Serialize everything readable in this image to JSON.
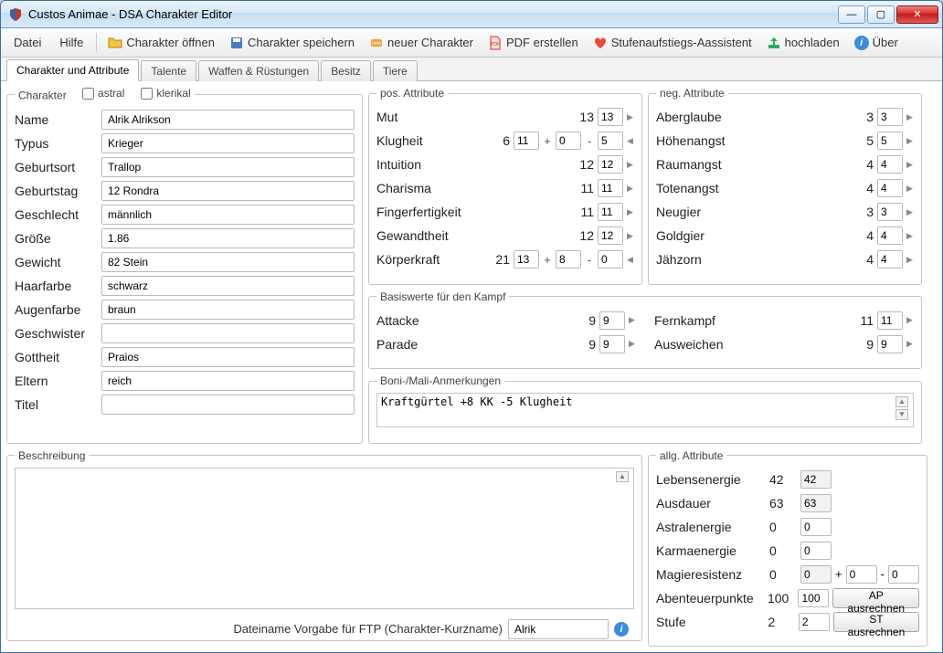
{
  "window": {
    "title": "Custos Animae - DSA Charakter Editor"
  },
  "menus": {
    "datei": "Datei",
    "hilfe": "Hilfe"
  },
  "toolbar": {
    "open": "Charakter öffnen",
    "save": "Charakter speichern",
    "new": "neuer Charakter",
    "pdf": "PDF erstellen",
    "levelup": "Stufenaufstiegs-Aassistent",
    "upload": "hochladen",
    "about": "Über"
  },
  "tabs": {
    "t0": "Charakter und Attribute",
    "t1": "Talente",
    "t2": "Waffen & Rüstungen",
    "t3": "Besitz",
    "t4": "Tiere"
  },
  "char": {
    "legend": "Charakter",
    "astral_lbl": "astral",
    "klerikal_lbl": "klerikal",
    "name_lbl": "Name",
    "name": "Alrik Alrikson",
    "typus_lbl": "Typus",
    "typus": "Krieger",
    "geburtsort_lbl": "Geburtsort",
    "geburtsort": "Trallop",
    "geburtstag_lbl": "Geburtstag",
    "geburtstag": "12 Rondra",
    "geschlecht_lbl": "Geschlecht",
    "geschlecht": "männlich",
    "groesse_lbl": "Größe",
    "groesse": "1.86",
    "gewicht_lbl": "Gewicht",
    "gewicht": "82 Stein",
    "haarfarbe_lbl": "Haarfarbe",
    "haarfarbe": "schwarz",
    "augenfarbe_lbl": "Augenfarbe",
    "augenfarbe": "braun",
    "geschwister_lbl": "Geschwister",
    "geschwister": "",
    "gottheit_lbl": "Gottheit",
    "gottheit": "Praios",
    "eltern_lbl": "Eltern",
    "eltern": "reich",
    "titel_lbl": "Titel",
    "titel": ""
  },
  "pos": {
    "legend": "pos. Attribute",
    "mut_lbl": "Mut",
    "mut_v": "13",
    "mut_i": "13",
    "klugheit_lbl": "Klugheit",
    "klugheit_v": "6",
    "klugheit_i1": "11",
    "klugheit_i2": "0",
    "klugheit_i3": "5",
    "intuition_lbl": "Intuition",
    "intuition_v": "12",
    "intuition_i": "12",
    "charisma_lbl": "Charisma",
    "charisma_v": "11",
    "charisma_i": "11",
    "ff_lbl": "Fingerfertigkeit",
    "ff_v": "11",
    "ff_i": "11",
    "ge_lbl": "Gewandtheit",
    "ge_v": "12",
    "ge_i": "12",
    "kk_lbl": "Körperkraft",
    "kk_v": "21",
    "kk_i1": "13",
    "kk_i2": "8",
    "kk_i3": "0"
  },
  "neg": {
    "legend": "neg. Attribute",
    "aberglaube_lbl": "Aberglaube",
    "aberglaube_v": "3",
    "aberglaube_i": "3",
    "hoehenangst_lbl": "Höhenangst",
    "hoehenangst_v": "5",
    "hoehenangst_i": "5",
    "raumangst_lbl": "Raumangst",
    "raumangst_v": "4",
    "raumangst_i": "4",
    "totenangst_lbl": "Totenangst",
    "totenangst_v": "4",
    "totenangst_i": "4",
    "neugier_lbl": "Neugier",
    "neugier_v": "3",
    "neugier_i": "3",
    "goldgier_lbl": "Goldgier",
    "goldgier_v": "4",
    "goldgier_i": "4",
    "jaehzorn_lbl": "Jähzorn",
    "jaehzorn_v": "4",
    "jaehzorn_i": "4"
  },
  "basis": {
    "legend": "Basiswerte für den Kampf",
    "attacke_lbl": "Attacke",
    "attacke_v": "9",
    "attacke_i": "9",
    "parade_lbl": "Parade",
    "parade_v": "9",
    "parade_i": "9",
    "fernkampf_lbl": "Fernkampf",
    "fernkampf_v": "11",
    "fernkampf_i": "11",
    "ausweichen_lbl": "Ausweichen",
    "ausweichen_v": "9",
    "ausweichen_i": "9"
  },
  "boni": {
    "legend": "Boni-/Mali-Anmerkungen",
    "text": "Kraftgürtel +8 KK -5 Klugheit"
  },
  "desc": {
    "legend": "Beschreibung",
    "text": ""
  },
  "allg": {
    "legend": "allg. Attribute",
    "le_lbl": "Lebensenergie",
    "le_v": "42",
    "le_i": "42",
    "au_lbl": "Ausdauer",
    "au_v": "63",
    "au_i": "63",
    "ae_lbl": "Astralenergie",
    "ae_v": "0",
    "ae_i": "0",
    "ke_lbl": "Karmaenergie",
    "ke_v": "0",
    "ke_i": "0",
    "mr_lbl": "Magieresistenz",
    "mr_v": "0",
    "mr_i1": "0",
    "mr_i2": "0",
    "mr_i3": "0",
    "ap_lbl": "Abenteuerpunkte",
    "ap_v": "100",
    "ap_i": "100",
    "ap_btn": "AP ausrechnen",
    "st_lbl": "Stufe",
    "st_v": "2",
    "st_i": "2",
    "st_btn": "ST ausrechnen"
  },
  "ftp": {
    "label": "Dateiname Vorgabe für FTP (Charakter-Kurzname)",
    "value": "Alrik"
  },
  "ops": {
    "plus": "+",
    "minus": "-"
  }
}
